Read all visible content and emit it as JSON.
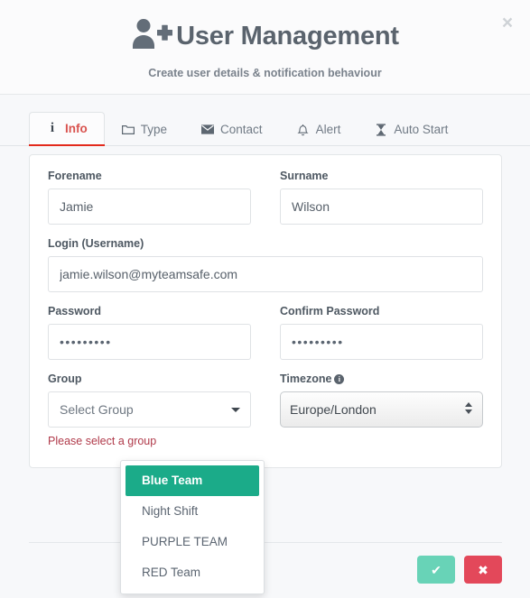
{
  "header": {
    "title": "User Management",
    "subtitle": "Create user details & notification behaviour",
    "icon": "user-plus-icon",
    "close_label": "×"
  },
  "tabs": [
    {
      "label": "Info",
      "icon": "info-icon",
      "active": true
    },
    {
      "label": "Type",
      "icon": "folder-icon",
      "active": false
    },
    {
      "label": "Contact",
      "icon": "envelope-icon",
      "active": false
    },
    {
      "label": "Alert",
      "icon": "bell-icon",
      "active": false
    },
    {
      "label": "Auto Start",
      "icon": "hourglass-icon",
      "active": false
    }
  ],
  "form": {
    "forename": {
      "label": "Forename",
      "value": "Jamie"
    },
    "surname": {
      "label": "Surname",
      "value": "Wilson"
    },
    "login": {
      "label": "Login (Username)",
      "value": "jamie.wilson@myteamsafe.com"
    },
    "password": {
      "label": "Password",
      "value": "•••••••••"
    },
    "confirm_password": {
      "label": "Confirm Password",
      "value": "•••••••••"
    },
    "group": {
      "label": "Group",
      "placeholder": "Select Group",
      "value": "",
      "error": "Please select a group"
    },
    "timezone": {
      "label": "Timezone",
      "info_icon": "info-circle-icon",
      "value": "Europe/London"
    }
  },
  "group_dropdown": {
    "open": true,
    "items": [
      {
        "label": "Blue Team",
        "highlighted": true
      },
      {
        "label": "Night Shift",
        "highlighted": false
      },
      {
        "label": "PURPLE TEAM",
        "highlighted": false
      },
      {
        "label": "RED Team",
        "highlighted": false
      }
    ]
  },
  "footer": {
    "confirm_label": "✔",
    "cancel_label": "✖"
  },
  "colors": {
    "accent_green": "#1bab89",
    "confirm": "#68d3b7",
    "cancel": "#e3485a",
    "active_tab_underline": "#e32a1c",
    "error_text": "#b03a4a"
  }
}
